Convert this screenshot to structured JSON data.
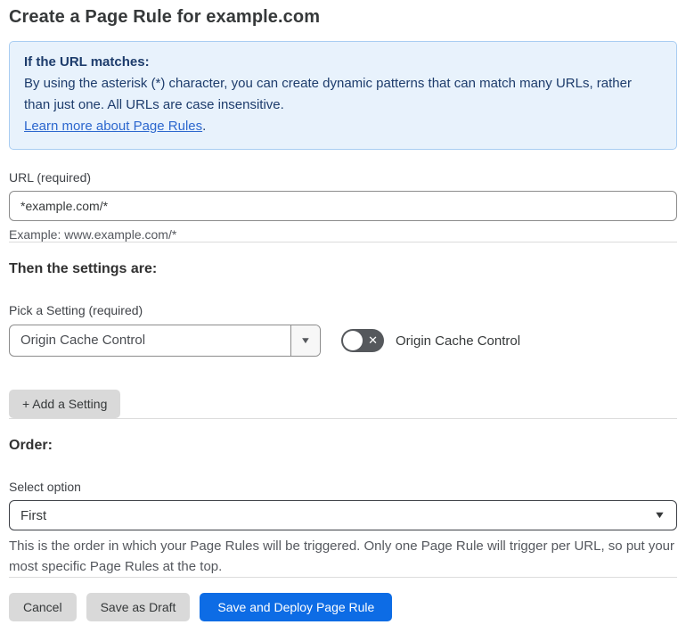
{
  "page": {
    "title": "Create a Page Rule for example.com"
  },
  "info_box": {
    "heading": "If the URL matches:",
    "body": "By using the asterisk (*) character, you can create dynamic patterns that can match many URLs, rather than just one. All URLs are case insensitive.",
    "link_label": "Learn more about Page Rules",
    "link_suffix": "."
  },
  "url_section": {
    "label": "URL (required)",
    "value": "*example.com/*",
    "example": "Example: www.example.com/*"
  },
  "settings_section": {
    "heading": "Then the settings are:",
    "pick_label": "Pick a Setting (required)",
    "selected_setting": "Origin Cache Control",
    "toggle_label": "Origin Cache Control",
    "toggle_state": "off",
    "add_button_label": "+ Add a Setting"
  },
  "order_section": {
    "heading": "Order:",
    "select_label": "Select option",
    "selected_option": "First",
    "help_text": "This is the order in which your Page Rules will be triggered. Only one Page Rule will trigger per URL, so put your most specific Page Rules at the top."
  },
  "footer": {
    "cancel_label": "Cancel",
    "save_draft_label": "Save as Draft",
    "save_deploy_label": "Save and Deploy Page Rule"
  },
  "icons": {
    "dropdown_arrow": "▼",
    "toggle_x": "✕"
  },
  "colors": {
    "accent_blue": "#0d6ce5",
    "info_bg": "#e8f2fc",
    "info_border": "#a9cdf2",
    "info_text": "#1d3c6c",
    "link_blue": "#2c67ce",
    "toggle_off_bg": "#55585c",
    "button_gray": "#d9d9d9"
  }
}
